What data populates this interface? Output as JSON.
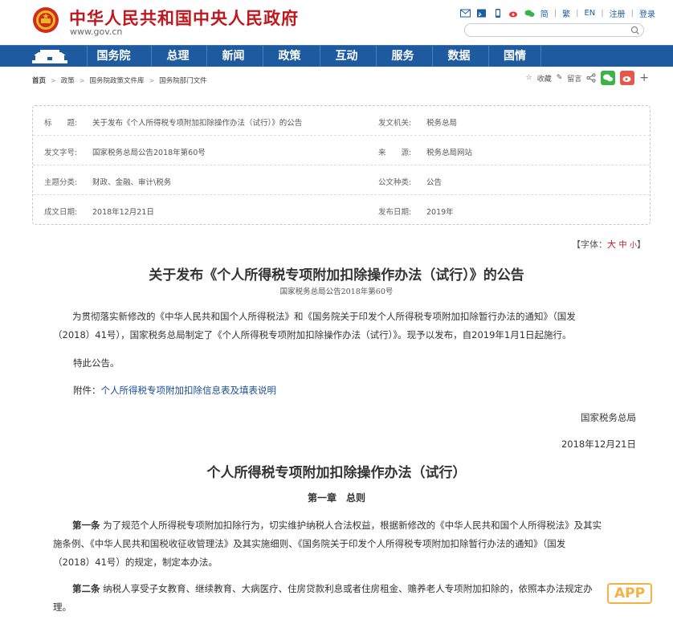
{
  "header": {
    "site_title": "中华人民共和国中央人民政府",
    "site_url": "www.gov.cn",
    "top_links": [
      "简",
      "繁",
      "EN",
      "注册",
      "登录"
    ],
    "search_placeholder": ""
  },
  "nav": {
    "items": [
      "国务院",
      "总理",
      "新闻",
      "政策",
      "互动",
      "服务",
      "数据",
      "国情"
    ]
  },
  "breadcrumb": [
    "首页",
    "政策",
    "国务院政策文件库",
    "国务院部门文件"
  ],
  "tools": {
    "favorite": "收藏",
    "comment": "留言"
  },
  "info": {
    "rows": [
      {
        "k1": "标　　题:",
        "v1": "关于发布《个人所得税专项附加扣除操作办法（试行）》的公告",
        "k2": "发文机关:",
        "v2": "税务总局"
      },
      {
        "k1": "发文字号:",
        "v1": "国家税务总局公告2018年第60号",
        "k2": "来　　源:",
        "v2": "税务总局网站"
      },
      {
        "k1": "主题分类:",
        "v1": "财政、金融、审计\\税务",
        "k2": "公文种类:",
        "v2": "公告"
      },
      {
        "k1": "成文日期:",
        "v1": "2018年12月21日",
        "k2": "发布日期:",
        "v2": "2019年"
      }
    ]
  },
  "font_size": {
    "prefix": "【字体：",
    "large": "大",
    "medium": "中",
    "small": "小",
    "suffix": "】"
  },
  "article": {
    "title": "关于发布《个人所得税专项附加扣除操作办法（试行）》的公告",
    "doc_number": "国家税务总局公告2018年第60号",
    "para1_line1": "为贯彻落实新修改的《中华人民共和国个人所得税法》和《国务院关于印发个人所得税专项附加扣除暂行办法的通知》（国发",
    "para1_line2": "（2018）41号），国家税务总局制定了《个人所得税专项附加扣除操作办法（试行）》。现予以发布，自2019年1月1日起施行。",
    "notice": "特此公告。",
    "attach_label": "附件：",
    "attach_link": "个人所得税专项附加扣除信息表及填表说明",
    "signer": "国家税务总局",
    "date": "2018年12月21日",
    "section_title": "个人所得税专项附加扣除操作办法（试行）",
    "chapter": "第一章　总则",
    "art1_head": "第一条",
    "art1_line1": "为了规范个人所得税专项附加扣除行为，切实维护纳税人合法权益，根据新修改的《中华人民共和国个人所得税法》及其实",
    "art1_line2": "施条例、《中华人民共和国税收征收管理法》及其实施细则、《国务院关于印发个人所得税专项附加扣除暂行办法的通知》（国发",
    "art1_line3": "（2018）41号）的规定，制定本办法。",
    "art2_head": "第二条",
    "art2_line1": "纳税人享受子女教育、继续教育、大病医疗、住房贷款利息或者住房租金、赡养老人专项附加扣除的，依照本办法规定办",
    "art2_line2": "理。"
  },
  "watermark": "APP",
  "colors": {
    "brand_red": "#c0161c",
    "nav_blue": "#1d5aa0",
    "link_blue": "#1a4d9a"
  }
}
